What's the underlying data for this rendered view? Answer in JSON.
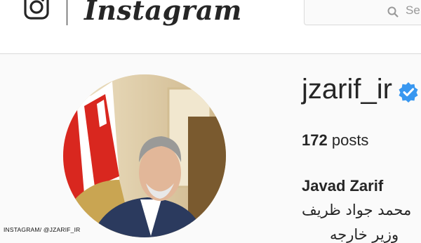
{
  "header": {
    "logo_text": "Instagram",
    "search": {
      "placeholder": "Se"
    }
  },
  "profile": {
    "username": "jzarif_ir",
    "verified": true,
    "posts_count": "172",
    "posts_label": "posts",
    "full_name": "Javad Zarif",
    "bio_line1": "محمد جواد ظريف",
    "bio_line2": "وزير خارجه"
  },
  "credit": "INSTAGRAM/ @JZARIF_IR",
  "colors": {
    "text": "#262626",
    "verified_badge": "#3897f0",
    "border": "#dbdbdb",
    "background": "#fafafa"
  },
  "icons": {
    "logo": "instagram-camera-icon",
    "search": "search-icon",
    "verified": "verified-badge-icon"
  }
}
